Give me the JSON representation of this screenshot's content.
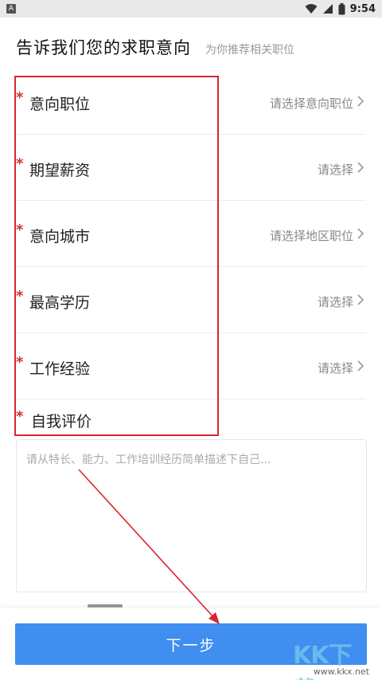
{
  "status_bar": {
    "app_badge": "A",
    "time": "9:54"
  },
  "page": {
    "title": "告诉我们您的求职意向",
    "subtitle": "为你推荐相关职位"
  },
  "rows": [
    {
      "label": "意向职位",
      "value": "请选择意向职位"
    },
    {
      "label": "期望薪资",
      "value": "请选择"
    },
    {
      "label": "意向城市",
      "value": "请选择地区职位"
    },
    {
      "label": "最高学历",
      "value": "请选择"
    },
    {
      "label": "工作经验",
      "value": "请选择"
    }
  ],
  "required_mark": "*",
  "self_evaluation": {
    "label": "自我评价",
    "placeholder": "请从特长、能力、工作培训经历简单描述下自己..."
  },
  "next_button": {
    "label": "下一步"
  },
  "watermark": {
    "text": "KK下载",
    "url": "www.kkx.net"
  },
  "colors": {
    "accent": "#3f8ef0",
    "required": "#d93025",
    "annotation": "#d9262c",
    "placeholder": "#aaaaaa"
  }
}
